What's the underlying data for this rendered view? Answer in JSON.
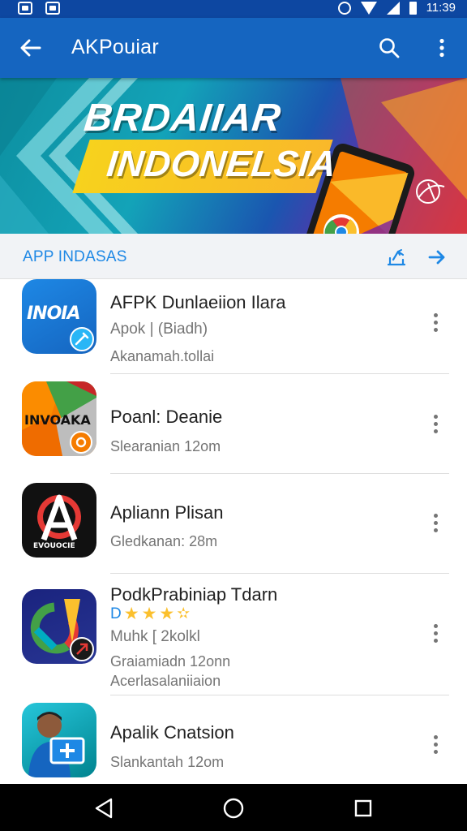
{
  "status_bar": {
    "time": "11:39"
  },
  "app_bar": {
    "title": "AKPouiar"
  },
  "banner": {
    "line1": "BRDAIIAR",
    "line2": "INDONELSIA"
  },
  "section": {
    "title": "APP INDASAS"
  },
  "items": [
    {
      "name": "AFPK Dunlaeiion Ilara",
      "line1": "Apok | (Biadh)",
      "line2": "Akanamah.tollai",
      "icon_text": "INOIA"
    },
    {
      "name": "Poanl: Deanie",
      "line1": "Slearanian 12om",
      "icon_text": "INVOAKA"
    },
    {
      "name": "Apliann Plisan",
      "line1": "Gledkanan: 28m",
      "icon_text": "EVOUOCIE"
    },
    {
      "name": "PodkPrabiniap Tdarn",
      "rating_prefix": "D",
      "rating": 3.5,
      "line1": "Muhk [ 2kolkl",
      "line2": "Graiamiadn 12onn",
      "line3": "Acerlasalaniiaion"
    },
    {
      "name": "Apalik Cnatsion",
      "line1": "Slankantah 12om"
    }
  ],
  "colors": {
    "app_bar": "#1565c0",
    "status_bar": "#0d47a1",
    "accent": "#1e88e5",
    "star": "#fbc02d"
  },
  "icons": [
    "back-arrow-icon",
    "search-icon",
    "more-vert-icon",
    "share-icon",
    "arrow-right-icon",
    "nav-back-icon",
    "nav-home-icon",
    "nav-recents-icon"
  ]
}
